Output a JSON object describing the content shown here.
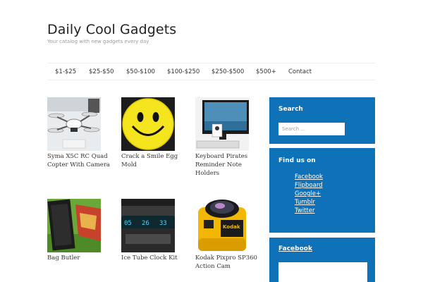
{
  "site": {
    "title": "Daily Cool Gadgets",
    "tagline": "Your catalog with new gadgets every day"
  },
  "nav": {
    "items": [
      "$1-$25",
      "$25-$50",
      "$50-$100",
      "$100-$250",
      "$250-$500",
      "$500+",
      "Contact"
    ]
  },
  "products": [
    {
      "title": "Syma X5C RC Quad Copter With Camera"
    },
    {
      "title": "Crack a Smile Egg Mold"
    },
    {
      "title": "Keyboard Pirates Reminder Note Holders"
    },
    {
      "title": "Bag Butler"
    },
    {
      "title": "Ice Tube Clock Kit"
    },
    {
      "title": "Kodak Pixpro SP360 Action Cam"
    }
  ],
  "sidebar": {
    "search": {
      "title": "Search",
      "placeholder": "Search ..."
    },
    "find_us": {
      "title": "Find us on",
      "links": [
        "Facebook",
        "Flipboard",
        "Google+",
        "Tumblr",
        "Twitter"
      ]
    },
    "facebook": {
      "title": "Facebook"
    }
  },
  "clock_digits": [
    "05",
    "26",
    "33"
  ],
  "camera_brand": "Kodak",
  "colors": {
    "sidebar_bg": "#0f72b9",
    "smiley": "#f4e51e"
  }
}
